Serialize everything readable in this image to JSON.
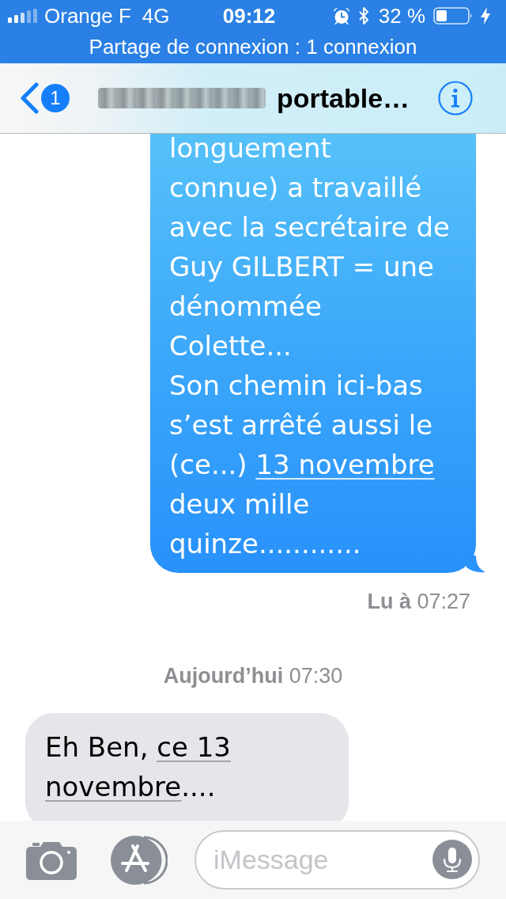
{
  "status_bar": {
    "carrier": "Orange F",
    "network": "4G",
    "time": "09:12",
    "battery": "32 %",
    "charging": true,
    "hotspot_banner": "Partage de connexion : 1 connexion"
  },
  "nav_bar": {
    "unread_badge": "1",
    "title": "portable…"
  },
  "messages": [
    {
      "kind": "outgoing",
      "lines": [
        [
          {
            "text": "longuement",
            "link": false
          }
        ],
        [
          {
            "text": "connue) a travaillé",
            "link": false
          }
        ],
        [
          {
            "text": "avec la secrétaire de",
            "link": false
          }
        ],
        [
          {
            "text": "Guy GILBERT = une",
            "link": false
          }
        ],
        [
          {
            "text": "dénommée",
            "link": false
          }
        ],
        [
          {
            "text": "Colette...",
            "link": false
          }
        ],
        [
          {
            "text": "Son chemin ici-bas",
            "link": false
          }
        ],
        [
          {
            "text": "s’est arrêté aussi le",
            "link": false
          }
        ],
        [
          {
            "text": "(ce...) ",
            "link": false
          },
          {
            "text": "13 novembre",
            "link": true
          }
        ],
        [
          {
            "text": "deux mille",
            "link": false
          }
        ],
        [
          {
            "text": "quinze............",
            "link": false
          }
        ]
      ]
    },
    {
      "kind": "receipt",
      "text": "**Lu à** 07:27"
    },
    {
      "kind": "timestamp",
      "text": "**Aujourd’hui** 07:30"
    },
    {
      "kind": "incoming",
      "lines": [
        [
          {
            "text": "Eh Ben, ",
            "link": false
          },
          {
            "text": "ce 13",
            "link": true
          }
        ],
        [
          {
            "text": "novembre",
            "link": true
          },
          {
            "text": "....",
            "link": false
          }
        ]
      ]
    }
  ],
  "composer": {
    "placeholder": "iMessage"
  }
}
